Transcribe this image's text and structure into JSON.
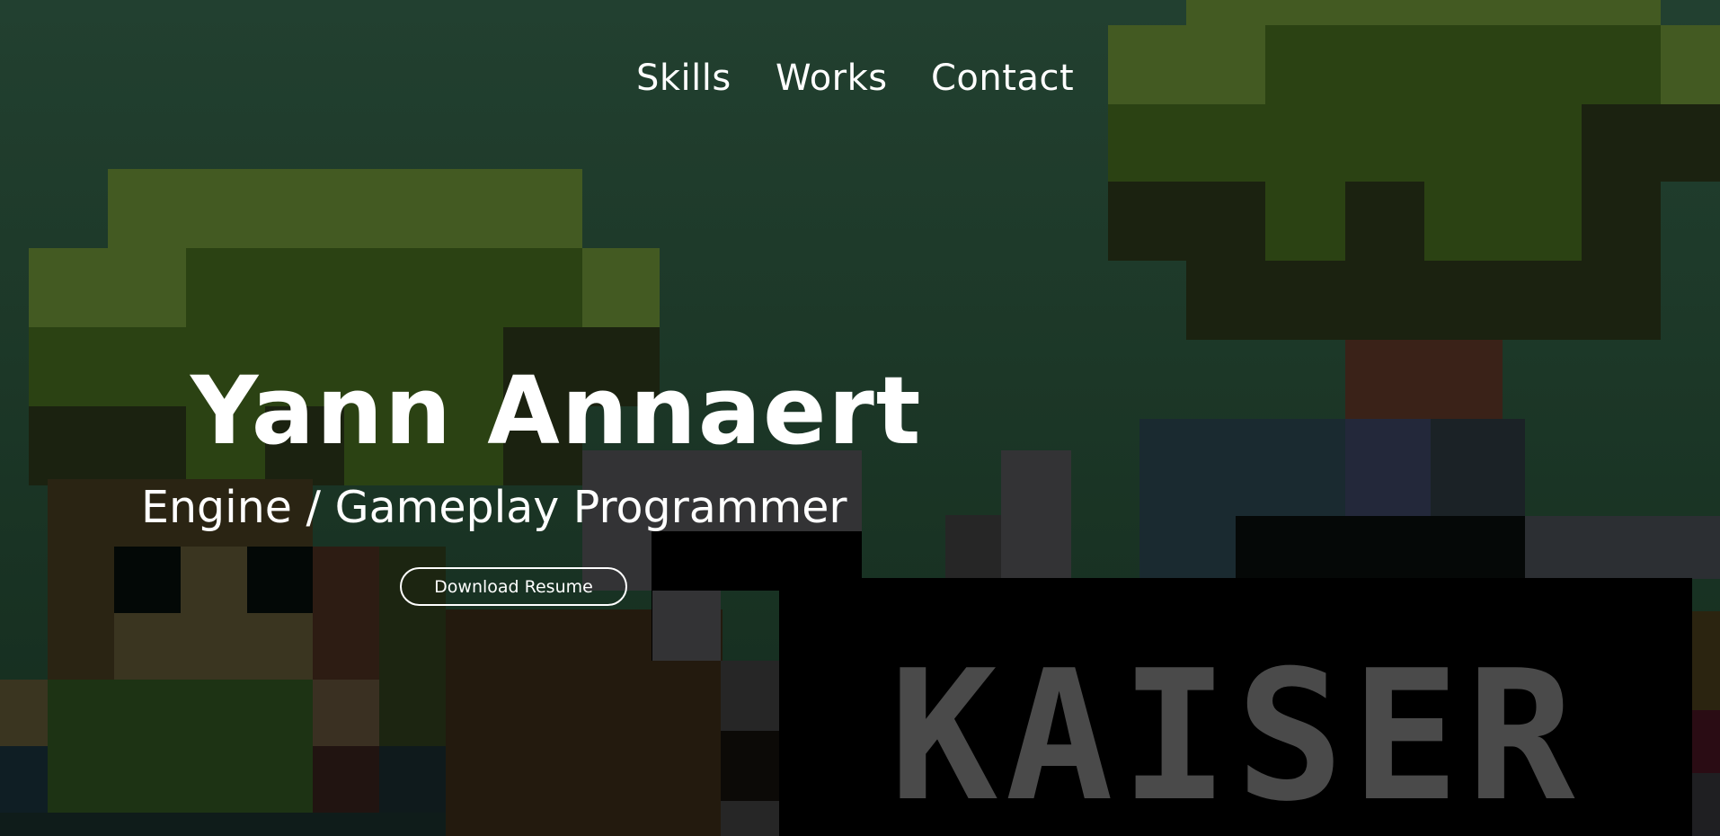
{
  "nav": {
    "items": [
      {
        "label": "Skills"
      },
      {
        "label": "Works"
      },
      {
        "label": "Contact"
      }
    ]
  },
  "hero": {
    "name": "Yann Annaert",
    "role": "Engine / Gameplay Programmer",
    "resume_button": "Download Resume",
    "background_logo_text": "KAISER"
  },
  "colors": {
    "background": "#1c3a2a",
    "text": "#ffffff",
    "leaf_light": "#435a22",
    "leaf_dark": "#2b4213",
    "shadow": "#1b2210",
    "trunk": "#3a2218",
    "logo_panel": "#000000",
    "logo_text": "#4a4a4a"
  }
}
